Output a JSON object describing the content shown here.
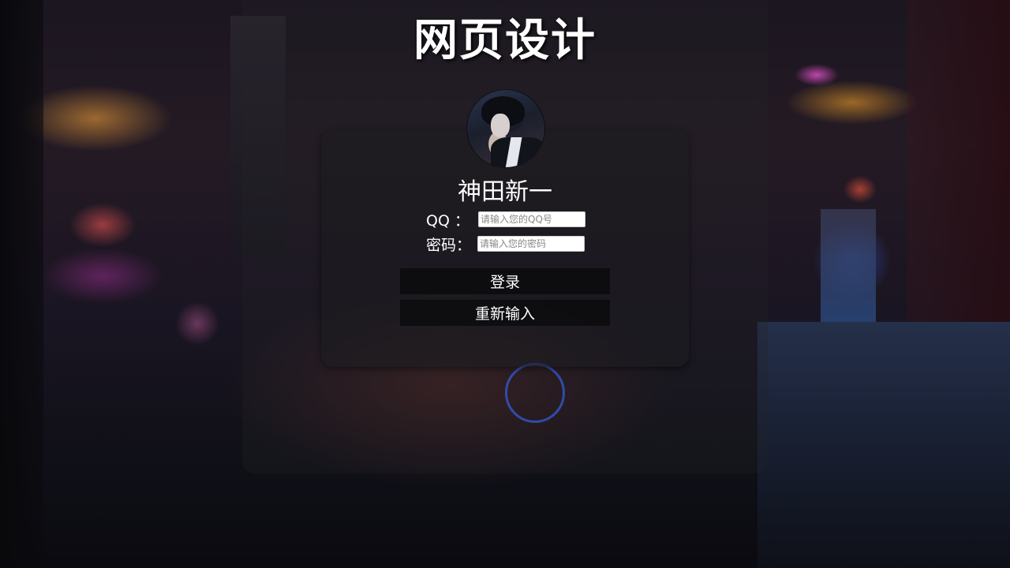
{
  "page": {
    "title": "网页设计"
  },
  "profile": {
    "username": "神田新一"
  },
  "form": {
    "qq_label": "QQ ：",
    "qq_placeholder": "请输入您的QQ号",
    "qq_value": "",
    "password_label": "密码：",
    "password_placeholder": "请输入您的密码",
    "password_value": ""
  },
  "buttons": {
    "login_label": "登录",
    "reset_label": "重新输入"
  },
  "colors": {
    "text": "#ffffff",
    "button_bg": "#0a0a0c",
    "card_bg": "#1c1c1e"
  }
}
